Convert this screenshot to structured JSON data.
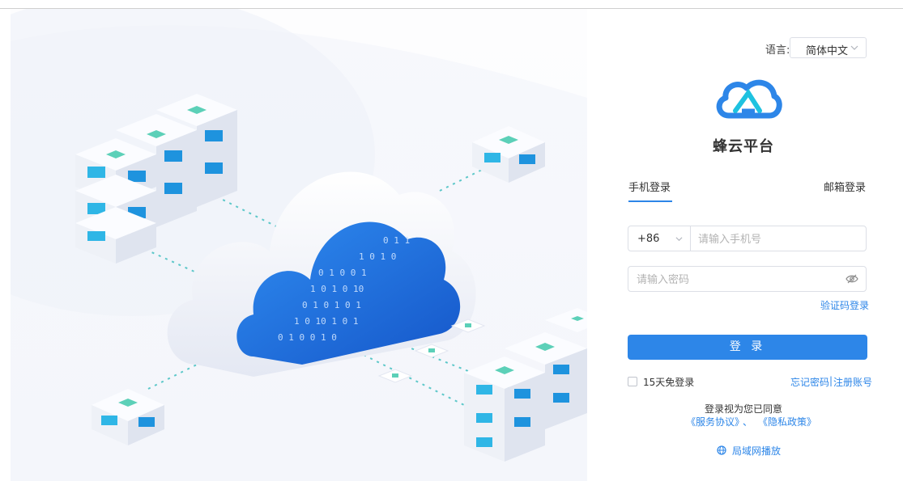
{
  "language": {
    "label": "语言:",
    "selected": "简体中文"
  },
  "brand": {
    "title": "蜂云平台"
  },
  "tabs": {
    "phone": "手机登录",
    "email": "邮箱登录"
  },
  "phone": {
    "country_code": "+86",
    "placeholder": "请输入手机号"
  },
  "password": {
    "placeholder": "请输入密码"
  },
  "links": {
    "code_login": "验证码登录",
    "forgot": "忘记密码",
    "separator": "|",
    "register": "注册账号"
  },
  "login_button": "登 录",
  "remember": "15天免登录",
  "agreement": {
    "text": "登录视为您已同意",
    "terms": "《服务协议》",
    "and": "、",
    "privacy": "《隐私政策》"
  },
  "lan_play": "局域网播放",
  "colors": {
    "accent": "#2d86e8",
    "border": "#dcdfe6"
  }
}
